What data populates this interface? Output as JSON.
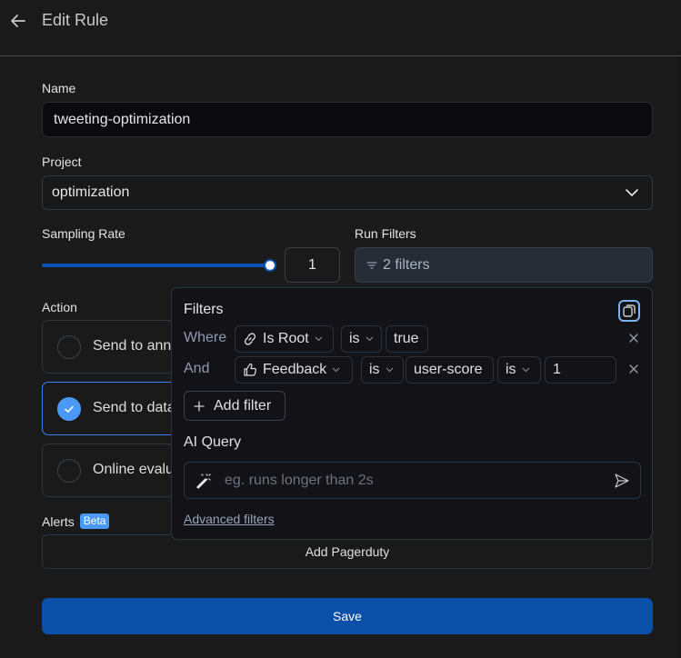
{
  "header": {
    "title": "Edit Rule",
    "back_icon": "arrow-left-icon"
  },
  "form": {
    "name": {
      "label": "Name",
      "value": "tweeting-optimization"
    },
    "project": {
      "label": "Project",
      "value": "optimization",
      "icon": "chevron-down-icon"
    },
    "sampling_rate": {
      "label": "Sampling Rate",
      "value": "1",
      "slider_fraction": 1.0
    },
    "run_filters": {
      "label": "Run Filters",
      "button_label": "2 filters",
      "icon": "filter-icon"
    },
    "action": {
      "label": "Action",
      "options": [
        {
          "label": "Send to annotation queue",
          "visible_label": "Send to ann",
          "selected": false
        },
        {
          "label": "Send to dataset",
          "visible_label": "Send to data",
          "selected": true
        },
        {
          "label": "Online evaluation",
          "visible_label": "Online evalu",
          "selected": false
        }
      ]
    },
    "alerts": {
      "label": "Alerts",
      "badge": "Beta",
      "add_button": "Add Pagerduty"
    },
    "save_button": "Save"
  },
  "filters_popover": {
    "title": "Filters",
    "copy_icon": "copy-icon",
    "rows": [
      {
        "connector": "Where",
        "field": "Is Root",
        "field_icon": "link-icon",
        "operator": "is",
        "value": "true"
      },
      {
        "connector": "And",
        "field": "Feedback",
        "field_icon": "thumbs-up-icon",
        "operator": "is",
        "key": "user-score",
        "key_operator": "is",
        "value": "1"
      }
    ],
    "add_filter_label": "Add filter",
    "ai_query": {
      "label": "AI Query",
      "placeholder": "eg. runs longer than 2s",
      "value": ""
    },
    "advanced_link": "Advanced filters"
  },
  "colors": {
    "background": "#1a1a1a",
    "primary": "#0a4fa8",
    "accent": "#4a9af5",
    "popover_bg": "#131317"
  }
}
